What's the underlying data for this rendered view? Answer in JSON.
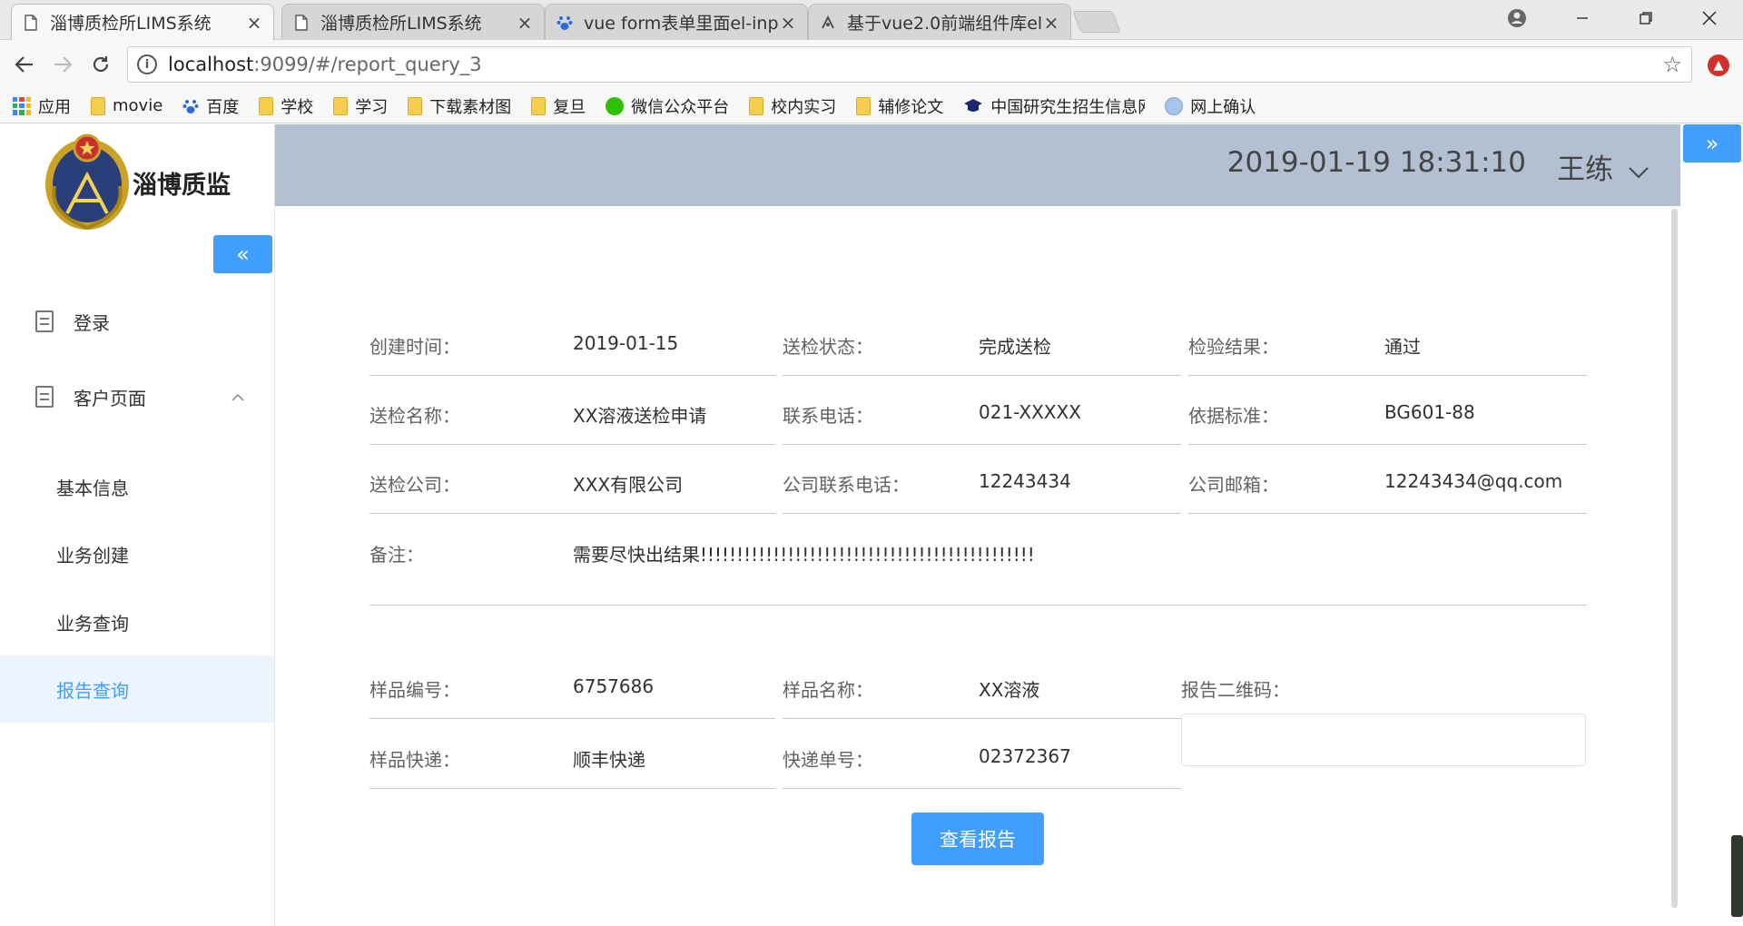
{
  "browser": {
    "tabs": [
      {
        "title": "淄博质检所LIMS系统",
        "active": true,
        "icon": "page-icon"
      },
      {
        "title": "淄博质检所LIMS系统",
        "active": false,
        "icon": "page-icon"
      },
      {
        "title": "vue form表单里面el-inp",
        "active": false,
        "icon": "baidu-paw-icon"
      },
      {
        "title": "基于vue2.0前端组件库el",
        "active": false,
        "icon": "csdn-icon"
      }
    ],
    "close_glyph": "×",
    "url_host": "localhost",
    "url_path": ":9099/#/report_query_3",
    "bookmarks": [
      {
        "label": "应用",
        "icon": "apps-grid-icon"
      },
      {
        "label": "movie",
        "icon": "folder-icon"
      },
      {
        "label": "百度",
        "icon": "baidu-paw-icon"
      },
      {
        "label": "学校",
        "icon": "folder-icon"
      },
      {
        "label": "学习",
        "icon": "folder-icon"
      },
      {
        "label": "下载素材图",
        "icon": "folder-icon"
      },
      {
        "label": "复旦",
        "icon": "folder-icon"
      },
      {
        "label": "微信公众平台",
        "icon": "wechat-icon"
      },
      {
        "label": "校内实习",
        "icon": "folder-icon"
      },
      {
        "label": "辅修论文",
        "icon": "folder-icon"
      },
      {
        "label": "中国研究生招生信息网",
        "icon": "graduation-cap-icon"
      },
      {
        "label": "网上确认",
        "icon": "globe-icon"
      }
    ]
  },
  "sidebar": {
    "logo_text": "淄博质监",
    "collapse_glyph": "«",
    "menu": [
      {
        "label": "登录"
      },
      {
        "label": "客户页面",
        "expanded": true
      }
    ],
    "submenu": [
      {
        "label": "基本信息",
        "active": false
      },
      {
        "label": "业务创建",
        "active": false
      },
      {
        "label": "业务查询",
        "active": false
      },
      {
        "label": "报告查询",
        "active": true
      }
    ]
  },
  "header": {
    "datetime": "2019-01-19 18:31:10",
    "user": "王练",
    "expand_glyph": "»"
  },
  "form": {
    "created_label": "创建时间：",
    "created_value": "2019-01-15",
    "status_label": "送检状态：",
    "status_value": "完成送检",
    "result_label": "检验结果：",
    "result_value": "通过",
    "name_label": "送检名称：",
    "name_value": "XX溶液送检申请",
    "phone_label": "联系电话：",
    "phone_value": "021-XXXXX",
    "standard_label": "依据标准：",
    "standard_value": "BG601-88",
    "company_label": "送检公司：",
    "company_value": "XXX有限公司",
    "company_phone_label": "公司联系电话：",
    "company_phone_value": "12243434",
    "company_email_label": "公司邮箱：",
    "company_email_value": "12243434@qq.com",
    "remark_label": "备注：",
    "remark_value": "需要尽快出结果!!!!!!!!!!!!!!!!!!!!!!!!!!!!!!!!!!!!!!!!!!!!!!",
    "sample_no_label": "样品编号：",
    "sample_no_value": "6757686",
    "sample_name_label": "样品名称：",
    "sample_name_value": "XX溶液",
    "qr_label": "报告二维码：",
    "courier_label": "样品快递：",
    "courier_value": "顺丰快递",
    "tracking_label": "快递单号：",
    "tracking_value": "02372367",
    "view_button": "查看报告"
  },
  "colors": {
    "primary": "#409eff",
    "header_bg": "#b3c0d1",
    "active_bg": "#ecf5ff"
  }
}
